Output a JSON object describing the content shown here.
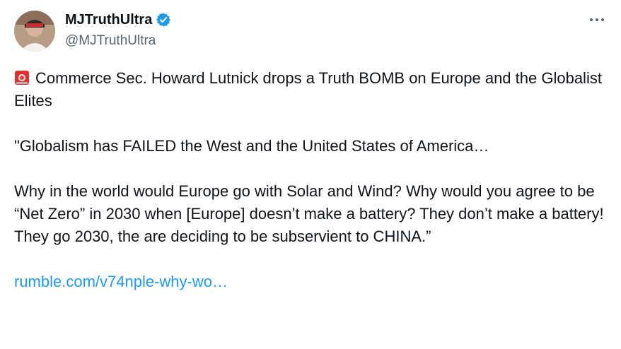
{
  "post": {
    "author": {
      "display_name": "MJTruthUltra",
      "handle": "@MJTruthUltra",
      "verified": true
    },
    "more_icon": "more-horizontal-icon",
    "headline_icon": "rotating-light-icon",
    "headline": "Commerce Sec. Howard Lutnick drops a Truth BOMB on Europe and the Globalist Elites",
    "quote_1": "\"Globalism has FAILED the West and the United States of America…",
    "quote_2": "Why in the world would Europe go with Solar and Wind? Why would you agree to be “Net Zero” in 2030 when [Europe] doesn’t make a battery? They don’t make a battery! They go 2030, the are deciding to be subservient to CHINA.”",
    "link_text": "rumble.com/v74nple-why-wo…"
  },
  "colors": {
    "text": "#0f1419",
    "secondary": "#536471",
    "link": "#1d9bf0",
    "verified": "#1d9bf0"
  }
}
